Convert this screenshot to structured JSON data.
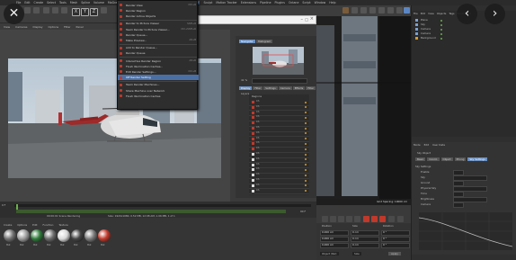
{
  "menubar": {
    "items": [
      "File",
      "Edit",
      "Create",
      "Select",
      "Tools",
      "Mesh",
      "Spline",
      "Volume",
      "MoGraph",
      "Character",
      "Animate",
      "Simulate",
      "Tracker",
      "Render",
      "Sculpt",
      "Motion Tracker",
      "Extensions",
      "Pipeline",
      "Plugins",
      "Octane",
      "Script",
      "Window",
      "Help"
    ],
    "active_index": 13
  },
  "xyz": {
    "x": "X",
    "y": "Y",
    "z": "Z"
  },
  "viewport_menu": [
    "View",
    "Cameras",
    "Display",
    "Options",
    "Filter",
    "Panel"
  ],
  "render_menu": {
    "items": [
      {
        "label": "Render View",
        "shortcut": "Ctrl+R"
      },
      {
        "label": "Render Region",
        "shortcut": ""
      },
      {
        "label": "Render Active Objects",
        "shortcut": ""
      },
      {
        "label": "Render to Picture Viewer",
        "shortcut": "Shift+R"
      },
      {
        "label": "Team Render to Picture Viewer...",
        "shortcut": "Ctrl+Shift+R"
      },
      {
        "label": "Render Queue...",
        "shortcut": ""
      },
      {
        "label": "Make Preview...",
        "shortcut": "Alt+B"
      },
      {
        "label": "Add to Render Queue...",
        "shortcut": ""
      },
      {
        "label": "Render Queue",
        "shortcut": ""
      },
      {
        "label": "Interactive Render Region",
        "shortcut": "Alt+R"
      },
      {
        "label": "Flush Illumination Caches...",
        "shortcut": ""
      },
      {
        "label": "Edit Render Settings...",
        "shortcut": "Ctrl+B"
      },
      {
        "label": "Off Render Setting",
        "shortcut": ""
      },
      {
        "label": "Team Render Machines...",
        "shortcut": ""
      },
      {
        "label": "Share Machine over Network",
        "shortcut": ""
      },
      {
        "label": "Flush Illumination Caches",
        "shortcut": ""
      }
    ],
    "highlight_index": 12
  },
  "right_tabs": [
    "Navigator",
    "Histogram"
  ],
  "zoom_level": "41 %",
  "layer_tabs": [
    "Display",
    "Filter",
    "Settings",
    "Camera",
    "Effects",
    "Filter",
    "Stereo"
  ],
  "layers_header": "Layers",
  "layers_sub": "Regions",
  "layer_rows": [
    "Ch",
    "Ch",
    "Ch",
    "Ch",
    "Ch",
    "Ch",
    "Ch",
    "Ch",
    "Ch",
    "Ch",
    "Ch",
    "Ch",
    "Ch",
    "Ch",
    "Ch",
    "Ch",
    "Ch",
    "Ch"
  ],
  "cam_status": "Grid Spacing: 10000 cm",
  "timeline": {
    "frame_start": "0 F",
    "frame_end": "90 F",
    "status_left": "00:00:01 Scene Rendering",
    "status_right": "Size: 1920x1080, 0.52 MB, 12:08 AM, 1.06 MB, 1 of 1"
  },
  "mat_tabs": [
    "Create",
    "Options",
    "Edit",
    "Function",
    "Texture"
  ],
  "materials": [
    {
      "name": "Mat",
      "color": "#6f6f6f"
    },
    {
      "name": "Mat",
      "color": "#9b9b9b"
    },
    {
      "name": "Mat",
      "color": "#2f7a3a"
    },
    {
      "name": "Mat",
      "color": "#6a6a6a"
    },
    {
      "name": "Mat",
      "color": "#d8d8d8"
    },
    {
      "name": "Mat",
      "color": "#444444"
    },
    {
      "name": "Mat",
      "color": "#7a7a7a"
    },
    {
      "name": "Mat",
      "color": "#c0392b"
    }
  ],
  "coords": {
    "headers": [
      "Position",
      "Size",
      "Rotation"
    ],
    "rows": [
      {
        "p": "0.000 cm",
        "s": "0 cm",
        "r": "0 °"
      },
      {
        "p": "0.000 cm",
        "s": "0 cm",
        "r": "0 °"
      },
      {
        "p": "0.000 cm",
        "s": "0 cm",
        "r": "0 °"
      }
    ],
    "mode": "Object (Rel)",
    "size_mode": "Size",
    "apply": "Apply"
  },
  "objects": {
    "tabs": [
      "File",
      "Edit",
      "View",
      "Objects",
      "Tags",
      "Bookmarks"
    ],
    "items": [
      "Plane",
      "Sky",
      "Camera",
      "Camera",
      "Background"
    ]
  },
  "attributes": {
    "tabs": [
      "Mode",
      "Edit",
      "User Data"
    ],
    "object": "Sky Object",
    "sub_tabs": [
      "Basic",
      "Coord.",
      "Object",
      "Phong",
      "Sky Settings"
    ],
    "section": "Sky Settings",
    "props": [
      "Enable",
      "Sky",
      "Ground",
      "Physical Sky",
      "Time",
      "Brightness",
      "Camera"
    ]
  },
  "nav": {
    "close": "✕",
    "back": "‹",
    "forward": "›"
  }
}
